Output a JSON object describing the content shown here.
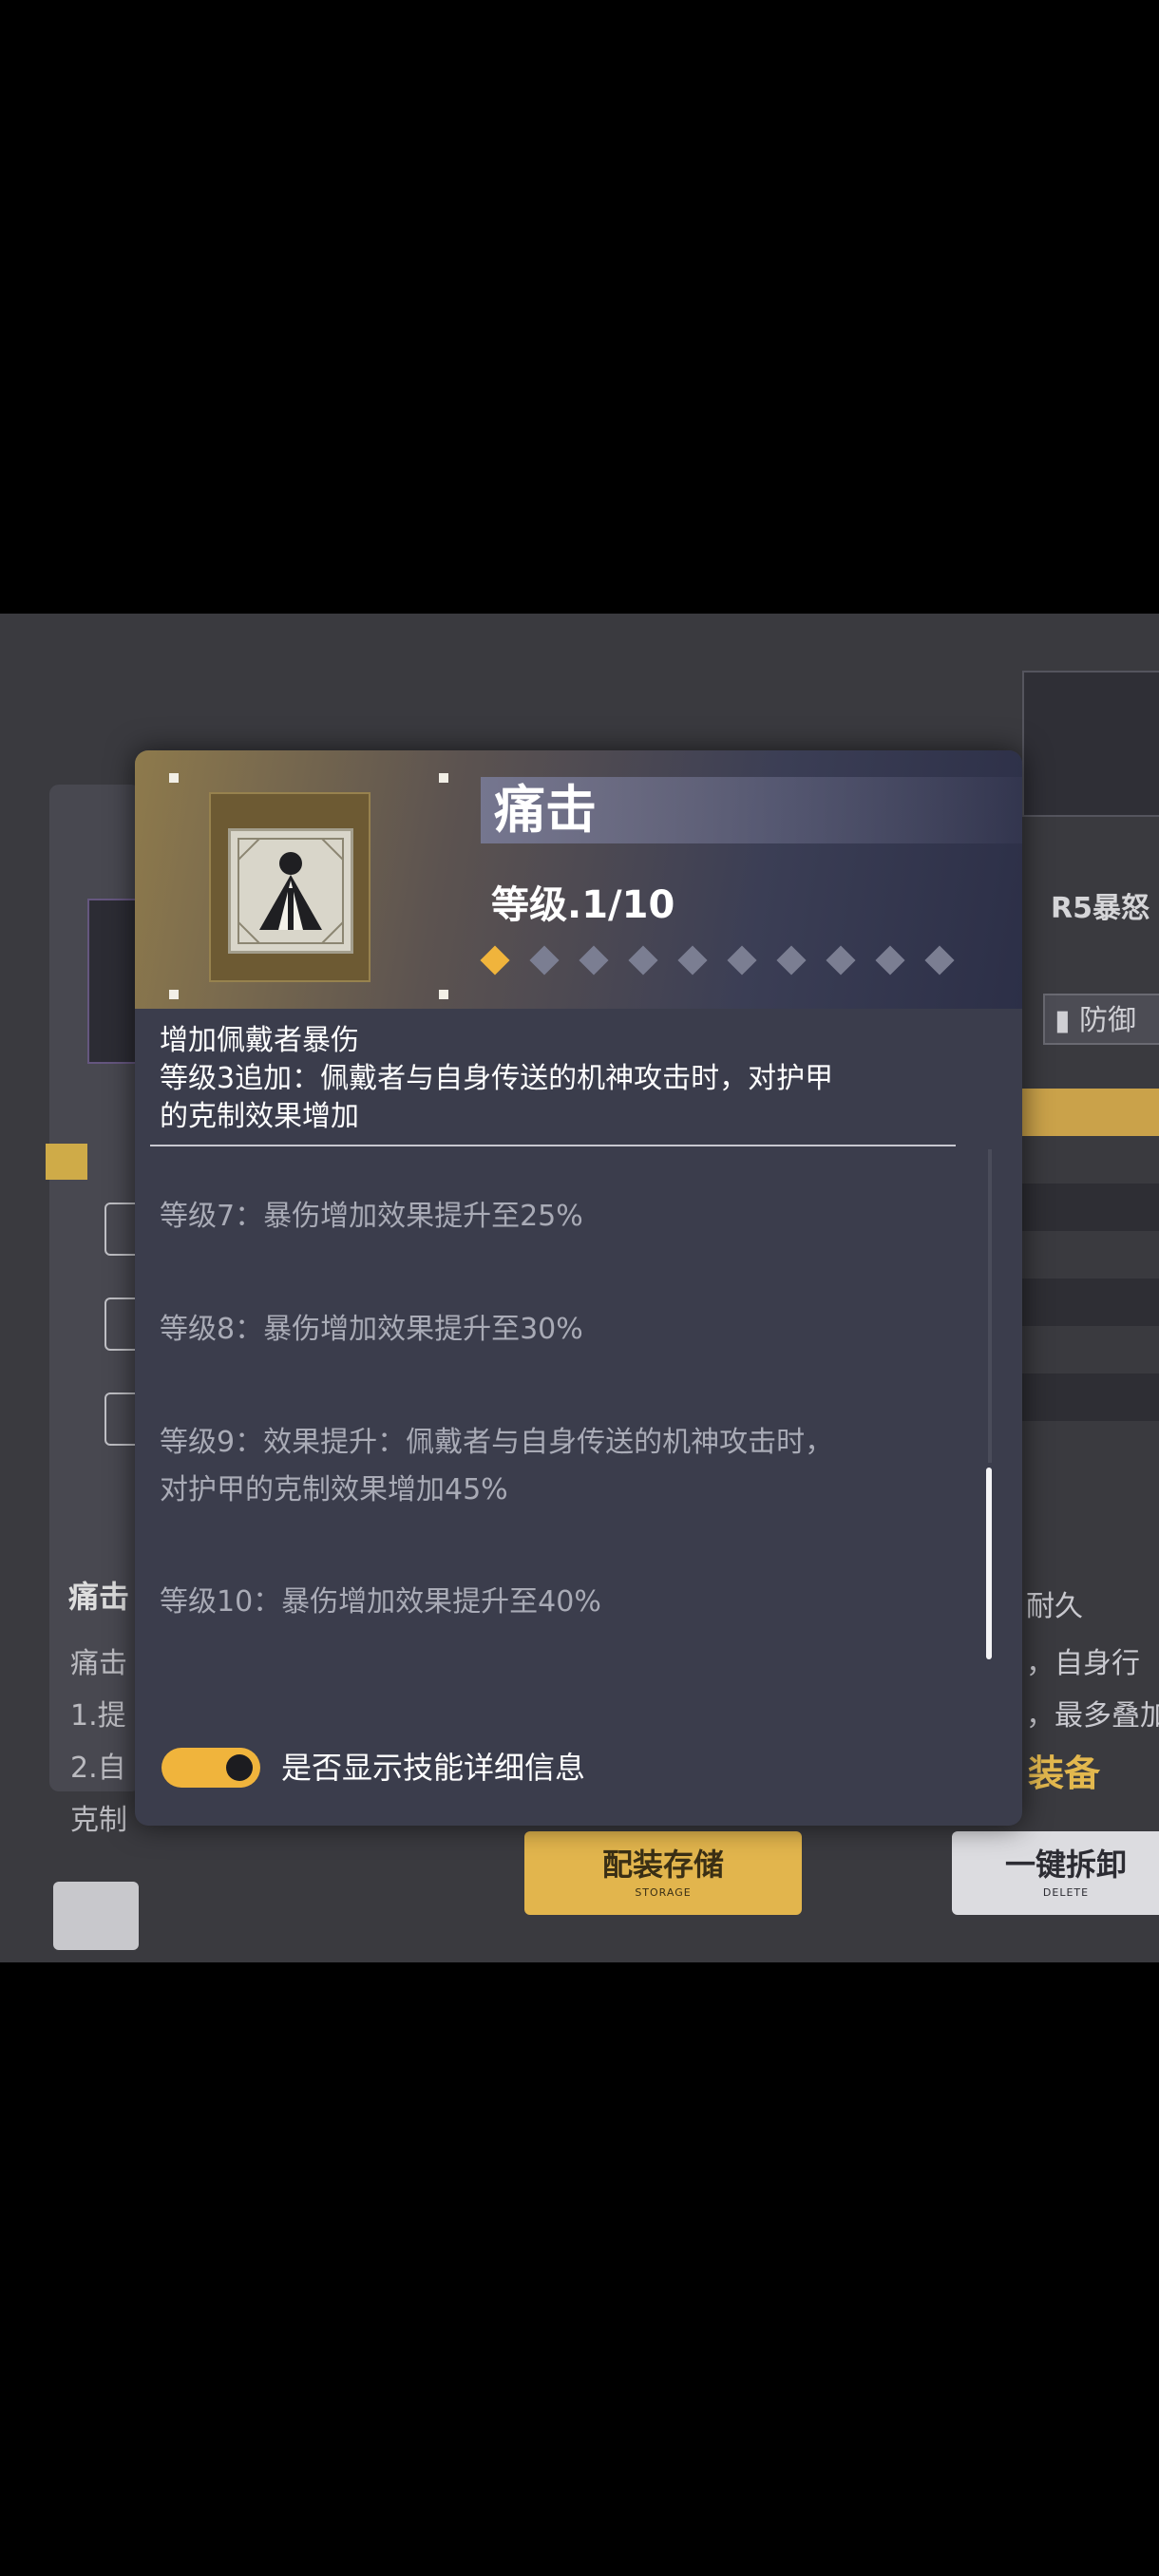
{
  "modal": {
    "skill_name": "痛击",
    "level_text": "等级.1/10",
    "level_current": 1,
    "level_max": 10,
    "description_lines": [
      "增加佩戴者暴伤",
      "等级3追加：佩戴者与自身传送的机神攻击时，对护甲",
      "的克制效果增加"
    ],
    "details": [
      "等级7：暴伤增加效果提升至25%",
      "等级8：暴伤增加效果提升至30%",
      "等级9：效果提升：佩戴者与自身传送的机神攻击时，",
      "对护甲的克制效果增加45%",
      "等级10：暴伤增加效果提升至40%"
    ],
    "toggle_label": "是否显示技能详细信息",
    "toggle_on": true
  },
  "background": {
    "left_title": "痛击",
    "left_lines": [
      "痛击",
      "1.提",
      "2.自",
      "克制"
    ],
    "right_title": "R5暴怒",
    "right_defense": "防御",
    "right_lines": [
      "耐久",
      "，自身行",
      "，最多叠加"
    ],
    "right_equip": "装备",
    "storage_button": "配装存储",
    "storage_sub": "STORAGE",
    "delete_button": "一键拆卸",
    "delete_sub": "DELETE"
  },
  "colors": {
    "accent": "#f0b43c",
    "modal_bg": "#3b3d4c",
    "inactive_diamond": "#7b7e92"
  }
}
